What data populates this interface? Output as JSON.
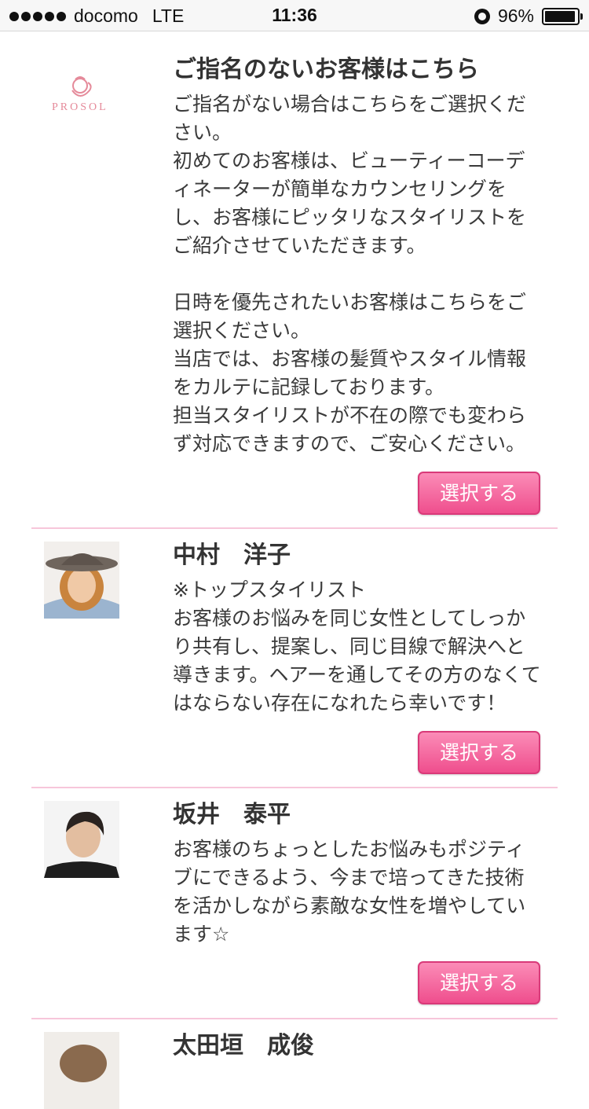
{
  "status_bar": {
    "carrier": "docomo",
    "network": "LTE",
    "time": "11:36",
    "battery": "96%",
    "battery_level": 0.96
  },
  "items": [
    {
      "logo_text": "PROSOL",
      "name": "ご指名のないお客様はこちら",
      "description": "ご指名がない場合はこちらをご選択ください。\n初めてのお客様は、ビューティーコーディネーターが簡単なカウンセリングをし、お客様にピッタリなスタイリストをご紹介させていただきます。\n\n日時を優先されたいお客様はこちらをご選択ください。\n当店では、お客様の髪質やスタイル情報をカルテに記録しております。\n担当スタイリストが不在の際でも変わらず対応できますので、ご安心ください。",
      "button": "選択する"
    },
    {
      "name": "中村　洋子",
      "description": "※トップスタイリスト\nお客様のお悩みを同じ女性としてしっかり共有し、提案し、同じ目線で解決へと導きます。ヘアーを通してその方のなくてはならない存在になれたら幸いです！",
      "button": "選択する"
    },
    {
      "name": "坂井　泰平",
      "description": "お客様のちょっとしたお悩みもポジティブにできるよう、今まで培ってきた技術を活かしながら素敵な女性を増やしています☆",
      "button": "選択する"
    },
    {
      "name": "太田垣　成俊"
    }
  ],
  "colors": {
    "accent": "#ef4e8d",
    "divider": "#f7c6da"
  }
}
